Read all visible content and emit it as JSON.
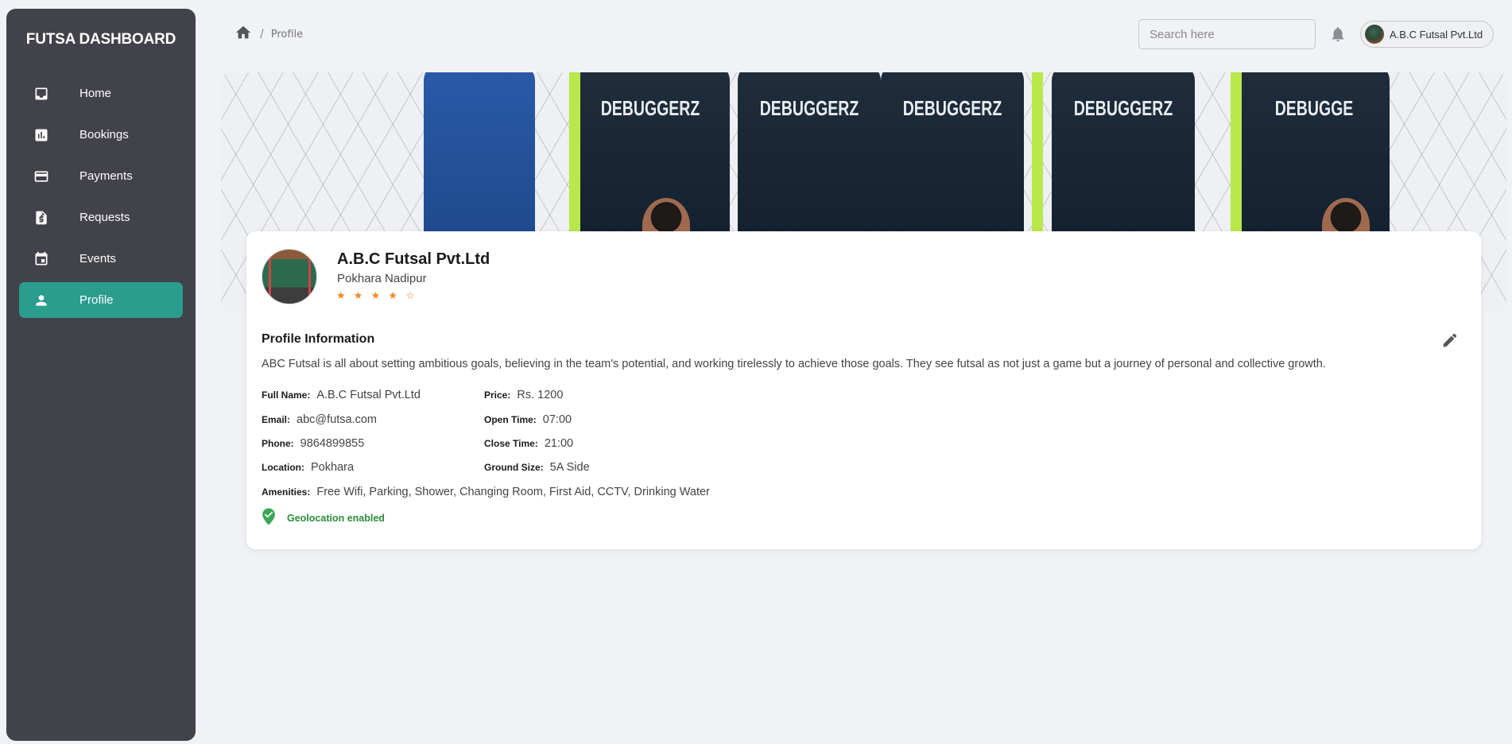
{
  "app": {
    "brand": "FUTSA DASHBOARD"
  },
  "sidebar": {
    "items": [
      {
        "label": "Home",
        "icon": "inbox-icon"
      },
      {
        "label": "Bookings",
        "icon": "bar-chart-icon"
      },
      {
        "label": "Payments",
        "icon": "credit-card-icon"
      },
      {
        "label": "Requests",
        "icon": "receipt-icon"
      },
      {
        "label": "Events",
        "icon": "calendar-icon"
      },
      {
        "label": "Profile",
        "icon": "person-icon",
        "active": true
      }
    ]
  },
  "header": {
    "breadcrumb": {
      "current": "Profile",
      "separator": "/"
    },
    "search": {
      "placeholder": "Search here",
      "value": ""
    },
    "user": {
      "name": "A.B.C Futsal Pvt.Ltd"
    }
  },
  "cover": {
    "jersey_text": [
      "DEBUGGERZ",
      "DEBUGGERZ",
      "DEBUGGERZ",
      "DEBUGGERZ",
      "DEBUGGE"
    ]
  },
  "profile": {
    "name": "A.B.C Futsal Pvt.Ltd",
    "location_line": "Pokhara Nadipur",
    "rating": 4,
    "rating_max": 5,
    "stars": "★ ★ ★ ★ ☆"
  },
  "info": {
    "title": "Profile Information",
    "description": "ABC Futsal is all about setting ambitious goals, believing in the team's potential, and working tirelessly to achieve those goals. They see futsal as not just a game but a journey of personal and collective growth.",
    "fields": {
      "full_name": {
        "label": "Full Name:",
        "value": "A.B.C Futsal Pvt.Ltd"
      },
      "email": {
        "label": "Email:",
        "value": "abc@futsa.com"
      },
      "phone": {
        "label": "Phone:",
        "value": "9864899855"
      },
      "location": {
        "label": "Location:",
        "value": "Pokhara"
      },
      "price": {
        "label": "Price:",
        "value": "Rs. 1200"
      },
      "open_time": {
        "label": "Open Time:",
        "value": "07:00"
      },
      "close_time": {
        "label": "Close Time:",
        "value": "21:00"
      },
      "ground_size": {
        "label": "Ground Size:",
        "value": "5A Side"
      },
      "amenities": {
        "label": "Amenities:",
        "value": "Free Wifi, Parking, Shower, Changing Room, First Aid, CCTV, Drinking Water"
      }
    },
    "geolocation": "Geolocation enabled"
  },
  "colors": {
    "sidebar_bg": "#42424a",
    "accent": "#2a9d8f",
    "star": "#ef8a23",
    "geo_green": "#2e8b3a"
  }
}
